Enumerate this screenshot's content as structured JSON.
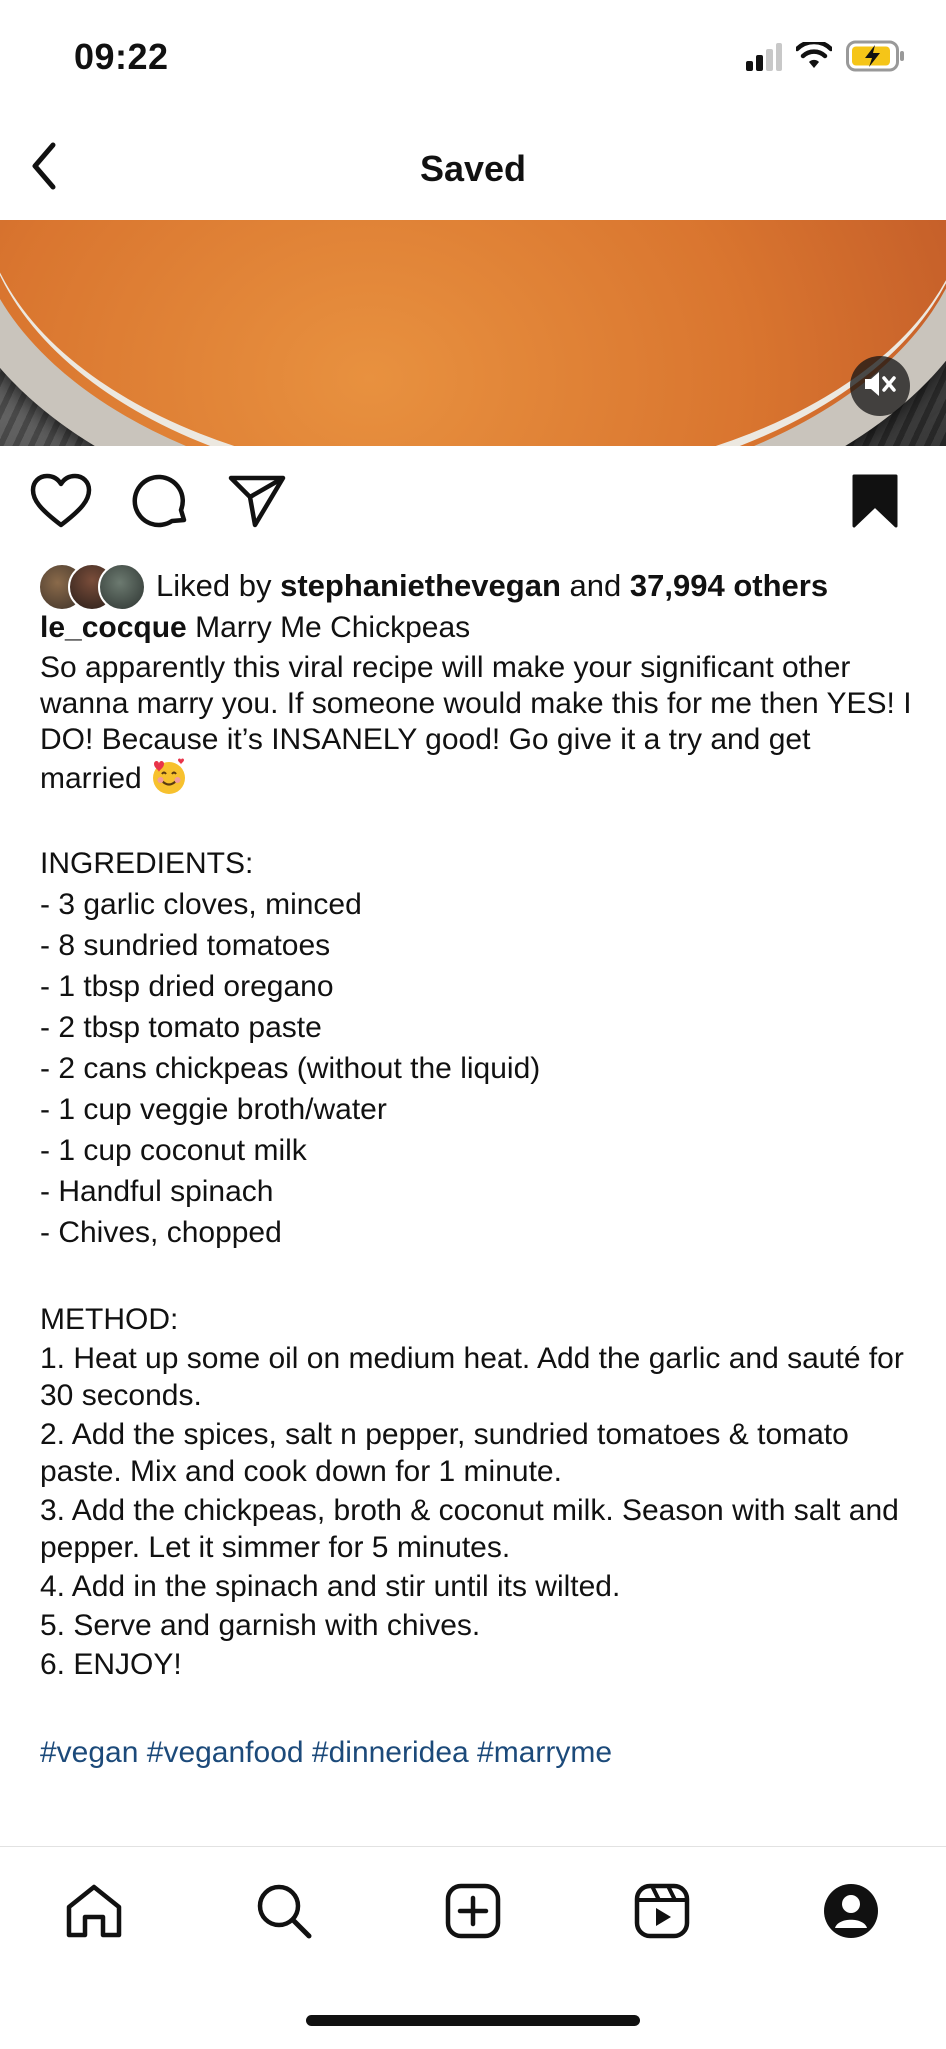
{
  "status_bar": {
    "time": "09:22",
    "icons": [
      "cellular-signal-icon",
      "wifi-icon",
      "battery-charging-icon"
    ]
  },
  "nav": {
    "title": "Saved",
    "back_icon": "chevron-left-icon"
  },
  "media": {
    "mute_icon": "speaker-muted-icon"
  },
  "actions": {
    "icons": [
      "heart-icon",
      "comment-icon",
      "share-icon",
      "bookmark-icon"
    ]
  },
  "likes": {
    "prefix": "Liked by",
    "user": "stephaniethevegan",
    "joiner": "and",
    "count": "37,994 others"
  },
  "caption": {
    "username": "le_cocque",
    "title": "Marry Me Chickpeas",
    "intro": "So apparently this viral recipe will make your significant other wanna marry you. If someone would make this for me then YES! I DO! Because it’s INSANELY good! Go give it a try and get married",
    "intro_emoji": "smiling-face-with-hearts",
    "ingredients_header": "INGREDIENTS:",
    "ingredients": [
      "- 3 garlic cloves, minced",
      "- 8 sundried tomatoes",
      "- 1 tbsp dried oregano",
      "- 2 tbsp tomato paste",
      "- 2 cans chickpeas (without the liquid)",
      "- 1 cup veggie broth/water",
      "- 1 cup coconut milk",
      "- Handful spinach",
      "- Chives, chopped"
    ],
    "method_header": "METHOD:",
    "method": [
      "1. Heat up some oil on medium heat. Add the garlic and sauté for 30 seconds.",
      "2. Add the spices, salt n pepper, sundried tomatoes & tomato paste. Mix and cook down for 1 minute.",
      "3. Add the chickpeas, broth & coconut milk. Season with salt and pepper. Let it simmer for 5 minutes.",
      "4. Add in the spinach and stir until its wilted.",
      "5. Serve and garnish with chives.",
      "6. ENJOY!"
    ],
    "hashtags": "#vegan #veganfood #dinneridea #marryme"
  },
  "tabbar": {
    "icons": [
      "home-icon",
      "search-icon",
      "create-post-icon",
      "reels-icon",
      "profile-icon"
    ]
  },
  "colors": {
    "hashtag": "#1c4a7a",
    "text": "#111111",
    "battery": "#f5c518"
  }
}
